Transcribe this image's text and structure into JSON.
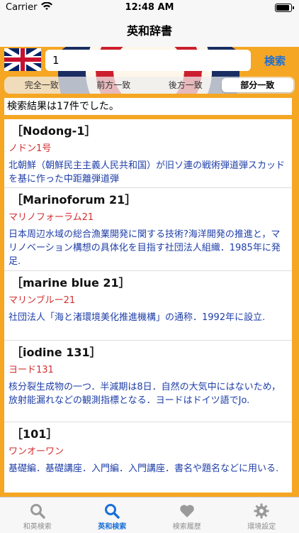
{
  "status_bar": {
    "carrier": "Carrier",
    "time": "12:48 AM"
  },
  "nav": {
    "title": "英和辞書"
  },
  "search": {
    "value": "1",
    "button_label": "検索"
  },
  "segments": [
    {
      "label": "完全一致",
      "active": false
    },
    {
      "label": "前方一致",
      "active": false
    },
    {
      "label": "後方一致",
      "active": false
    },
    {
      "label": "部分一致",
      "active": true
    }
  ],
  "results": {
    "summary": "検索結果は17件でした。",
    "entries": [
      {
        "headword": "［Nodong-1］",
        "reading": "ノドン1号",
        "definition": "北朝鮮（朝鮮民主主義人民共和国）が旧ソ連の戦術弾道弾スカッドを基に作った中距離弾道弾"
      },
      {
        "headword": "［Marinoforum 21］",
        "reading": "マリノフォーラム21",
        "definition": "日本周辺水域の総合漁業開発に関する技術?海洋開発の推進と，マリノベーション構想の具体化を目指す社団法人組織．1985年に発足."
      },
      {
        "headword": "［marine blue 21］",
        "reading": "マリンブルー21",
        "definition": "社団法人「海と渚環境美化推進機構」の通称．1992年に設立."
      },
      {
        "headword": "［iodine 131］",
        "reading": "ヨード131",
        "definition": "核分裂生成物の一つ．半減期は8日．自然の大気中にはないため，放射能漏れなどの観測指標となる．ヨードはドイツ語でJo."
      },
      {
        "headword": "［101］",
        "reading": "ワンオーワン",
        "definition": "基礎編．基礎講座．入門編．入門講座．書名や題名などに用いる."
      }
    ]
  },
  "tabbar": [
    {
      "label": "和英検索",
      "icon": "search-icon",
      "active": false
    },
    {
      "label": "英和検索",
      "icon": "search-icon",
      "active": true
    },
    {
      "label": "検索履歴",
      "icon": "heart-icon",
      "active": false
    },
    {
      "label": "環境設定",
      "icon": "gear-icon",
      "active": false
    }
  ],
  "colors": {
    "accent": "#f5a623",
    "link": "#1a6fd8",
    "reading": "#d32f2f",
    "definition": "#1f3fa8"
  }
}
